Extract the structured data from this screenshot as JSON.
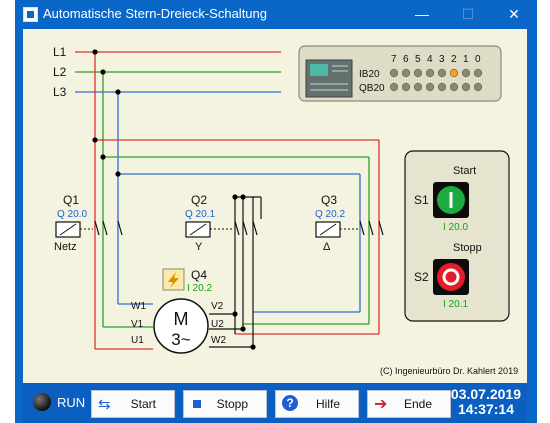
{
  "window": {
    "title": "Automatische Stern-Dreieck-Schaltung",
    "minimize_glyph": "—",
    "maximize_glyph": "☐",
    "close_glyph": "✕"
  },
  "phases": {
    "l1": "L1",
    "l2": "L2",
    "l3": "L3"
  },
  "contactors": {
    "q1": {
      "name": "Q1",
      "address": "Q 20.0",
      "label": "Netz"
    },
    "q2": {
      "name": "Q2",
      "address": "Q 20.1",
      "label": "Y"
    },
    "q3": {
      "name": "Q3",
      "address": "Q 20.2",
      "label": "Δ"
    },
    "q4": {
      "name": "Q4",
      "address": "I 20.2"
    }
  },
  "motor": {
    "letter": "M",
    "type": "3~",
    "terminals": {
      "w1": "W1",
      "v1": "V1",
      "u1": "U1",
      "v2": "V2",
      "u2": "U2",
      "w2": "W2"
    }
  },
  "plc": {
    "bit_numbers": [
      "7",
      "6",
      "5",
      "4",
      "3",
      "2",
      "1",
      "0"
    ],
    "ib_label": "IB20",
    "qb_label": "QB20",
    "ib_lit_bit": "2"
  },
  "panel": {
    "start_caption": "Start",
    "s1_label": "S1",
    "s1_address": "I 20.0",
    "stop_caption": "Stopp",
    "s2_label": "S2",
    "s2_address": "I 20.1"
  },
  "copyright": "(C) Ingenieurbüro Dr. Kahlert 2019",
  "toolbar": {
    "run_label": "RUN",
    "start_label": "Start",
    "stop_label": "Stopp",
    "help_label": "Hilfe",
    "exit_label": "Ende",
    "date": "03.07.2019",
    "time": "14:37:14"
  },
  "colors": {
    "l1": "#e03030",
    "l2": "#2ba02b",
    "l3": "#2d6fd0",
    "address_blue": "#1f5fd0",
    "address_green": "#16a016",
    "titlebar": "#0a67c7",
    "toolbar": "#0b5fc1",
    "led_on": "#ffa21a",
    "led_off": "#8a8a74"
  }
}
